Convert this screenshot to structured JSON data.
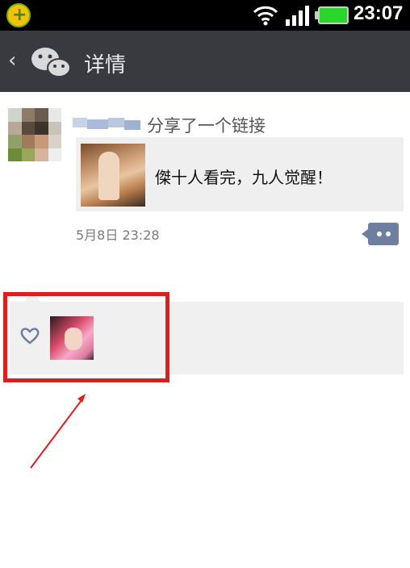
{
  "status_bar": {
    "time": "23:07",
    "app_icon": "360-security-icon",
    "wifi_icon": "wifi-icon",
    "signal_icon": "signal-icon",
    "battery_icon": "battery-icon"
  },
  "header": {
    "title": "详情",
    "back_icon": "back-chevron-icon",
    "logo_icon": "wechat-logo-icon"
  },
  "post": {
    "username": "",
    "action": "分享了一个链接",
    "link": {
      "title": "傑十人看完，九人觉醒！"
    },
    "timestamp": "5月8日 23:28",
    "comment_icon": "comment-icon"
  },
  "likes": {
    "icon": "heart-icon"
  },
  "colors": {
    "title_bar": "#393a3f",
    "link_card_bg": "#efefef",
    "likes_bg": "#f0f0f0",
    "highlight": "#e41b1b",
    "comment_button": "#6f7fa0"
  }
}
